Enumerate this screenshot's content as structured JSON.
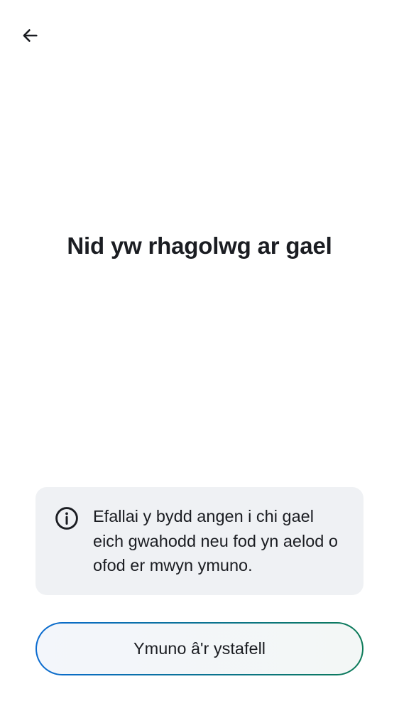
{
  "header": {
    "back_icon": "arrow-left-icon"
  },
  "main": {
    "title": "Nid yw rhagolwg ar gael"
  },
  "notice": {
    "icon": "info-circle-icon",
    "text": "Efallai y bydd angen i chi gael eich gwahodd neu fod yn aelod o ofod er mwyn ymuno."
  },
  "actions": {
    "join_label": "Ymuno â'r ystafell"
  },
  "colors": {
    "background": "#ffffff",
    "text": "#1b1d22",
    "notice_background": "#eff1f4",
    "button_border_start": "#0a6bd1",
    "button_border_end": "#0b7a57"
  }
}
